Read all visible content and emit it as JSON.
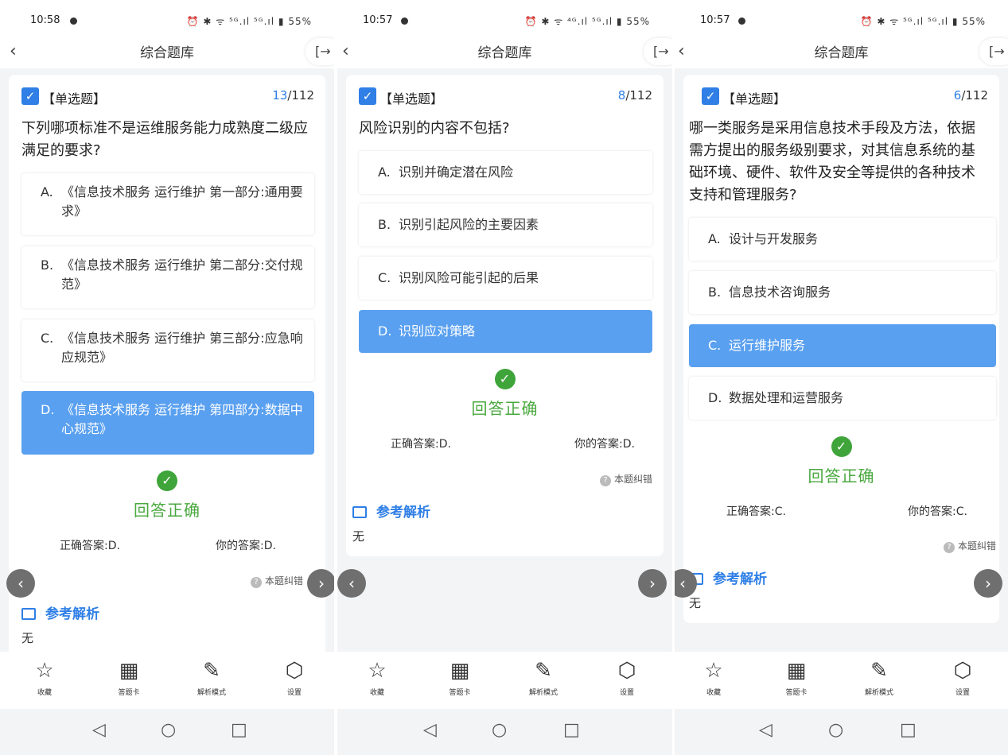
{
  "panels": [
    {
      "status": {
        "time": "10:58",
        "icons": "⏰ ✱ ᯤ ⁵ᴳ.ıl ⁵ᴳ.ıl ▮ 55%"
      },
      "nav": {
        "title": "综合题库",
        "back_icon": "‹",
        "exit_icon": "[→"
      },
      "question": {
        "type": "【单选题】",
        "current": "13",
        "total": "/112",
        "text": "下列哪项标准不是运维服务能力成熟度二级应满足的要求?"
      },
      "options": [
        {
          "letter": "A.",
          "text": "《信息技术服务 运行维护 第一部分:通用要求》"
        },
        {
          "letter": "B.",
          "text": "《信息技术服务 运行维护 第二部分:交付规范》"
        },
        {
          "letter": "C.",
          "text": "《信息技术服务 运行维护 第三部分:应急响应规范》"
        },
        {
          "letter": "D.",
          "text": "《信息技术服务 运行维护 第四部分:数据中心规范》"
        }
      ],
      "result": {
        "text": "回答正确",
        "correct": "正确答案:D.",
        "yours": "你的答案:D."
      },
      "correction": "本题纠错",
      "analysis": {
        "title": "参考解析",
        "body": "无"
      }
    },
    {
      "status": {
        "time": "10:57",
        "icons": "⏰ ✱ ᯤ ⁴ᴳ.ıl ⁵ᴳ.ıl ▮ 55%"
      },
      "nav": {
        "title": "综合题库",
        "back_icon": "‹",
        "exit_icon": "[→"
      },
      "question": {
        "type": "【单选题】",
        "current": "8",
        "total": "/112",
        "text": "风险识别的内容不包括?"
      },
      "options": [
        {
          "letter": "A.",
          "text": "识别并确定潜在风险"
        },
        {
          "letter": "B.",
          "text": "识别引起风险的主要因素"
        },
        {
          "letter": "C.",
          "text": "识别风险可能引起的后果"
        },
        {
          "letter": "D.",
          "text": "识别应对策略"
        }
      ],
      "result": {
        "text": "回答正确",
        "correct": "正确答案:D.",
        "yours": "你的答案:D."
      },
      "correction": "本题纠错",
      "analysis": {
        "title": "参考解析",
        "body": "无"
      }
    },
    {
      "status": {
        "time": "10:57",
        "icons": "⏰ ✱ ᯤ ⁵ᴳ.ıl ⁵ᴳ.ıl ▮ 55%"
      },
      "nav": {
        "title": "综合题库",
        "back_icon": "‹",
        "exit_icon": "[→"
      },
      "question": {
        "type": "【单选题】",
        "current": "6",
        "total": "/112",
        "text": "哪一类服务是采用信息技术手段及方法，依据需方提出的服务级别要求，对其信息系统的基础环境、硬件、软件及安全等提供的各种技术支持和管理服务?"
      },
      "options": [
        {
          "letter": "A.",
          "text": "设计与开发服务"
        },
        {
          "letter": "B.",
          "text": "信息技术咨询服务"
        },
        {
          "letter": "C.",
          "text": "运行维护服务"
        },
        {
          "letter": "D.",
          "text": "数据处理和运营服务"
        }
      ],
      "result": {
        "text": "回答正确",
        "correct": "正确答案:C.",
        "yours": "你的答案:C."
      },
      "correction": "本题纠错",
      "analysis": {
        "title": "参考解析",
        "body": "无"
      }
    }
  ],
  "tabbar": [
    {
      "icon": "☆",
      "label": "收藏"
    },
    {
      "icon": "▦",
      "label": "答题卡"
    },
    {
      "icon": "✎",
      "label": "解析模式"
    },
    {
      "icon": "⬡",
      "label": "设置"
    }
  ],
  "sysnav": {
    "back": "◁",
    "home": "○",
    "recents": "□"
  },
  "arrows": {
    "prev": "‹",
    "next": "›"
  },
  "icons": {
    "check": "✓",
    "ok": "✓",
    "help": "?"
  },
  "colors": {
    "accent": "#2f7fe6",
    "selected": "#5aa0f0",
    "success": "#4aa83f"
  }
}
